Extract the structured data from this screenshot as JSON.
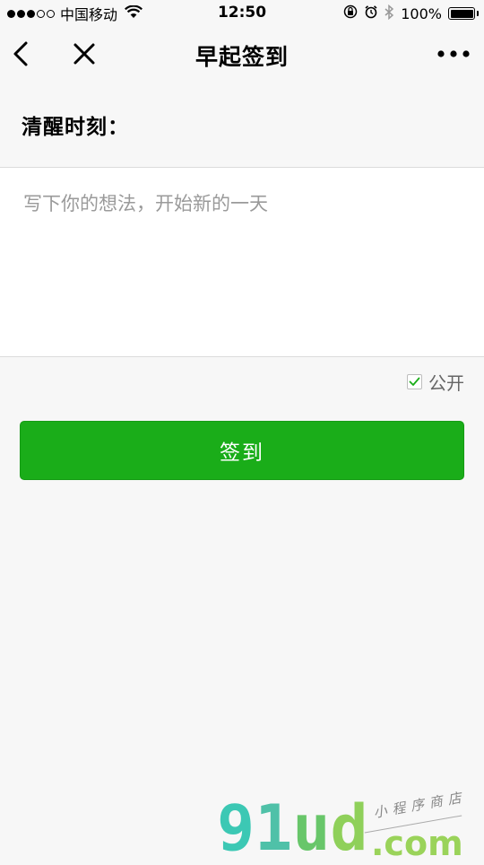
{
  "status_bar": {
    "carrier": "中国移动",
    "time": "12:50",
    "battery_percent": "100%",
    "battery_level": 1.0,
    "signal_bars_filled": 3,
    "signal_bars_total": 5
  },
  "nav": {
    "title": "早起签到",
    "back_icon": "chevron-left",
    "close_icon": "close-x",
    "more_icon": "more-dots"
  },
  "form": {
    "section_label": "清醒时刻：",
    "textarea_placeholder": "写下你的想法，开始新的一天",
    "textarea_value": "",
    "public_label": "公开",
    "public_checked": true,
    "submit_label": "签到"
  },
  "watermark": {
    "logo": [
      "9",
      "1",
      "u",
      "d"
    ],
    "domain": ".com",
    "tagline": "小程序商店"
  },
  "colors": {
    "primary_green": "#1aad19",
    "background": "#f7f7f7"
  }
}
